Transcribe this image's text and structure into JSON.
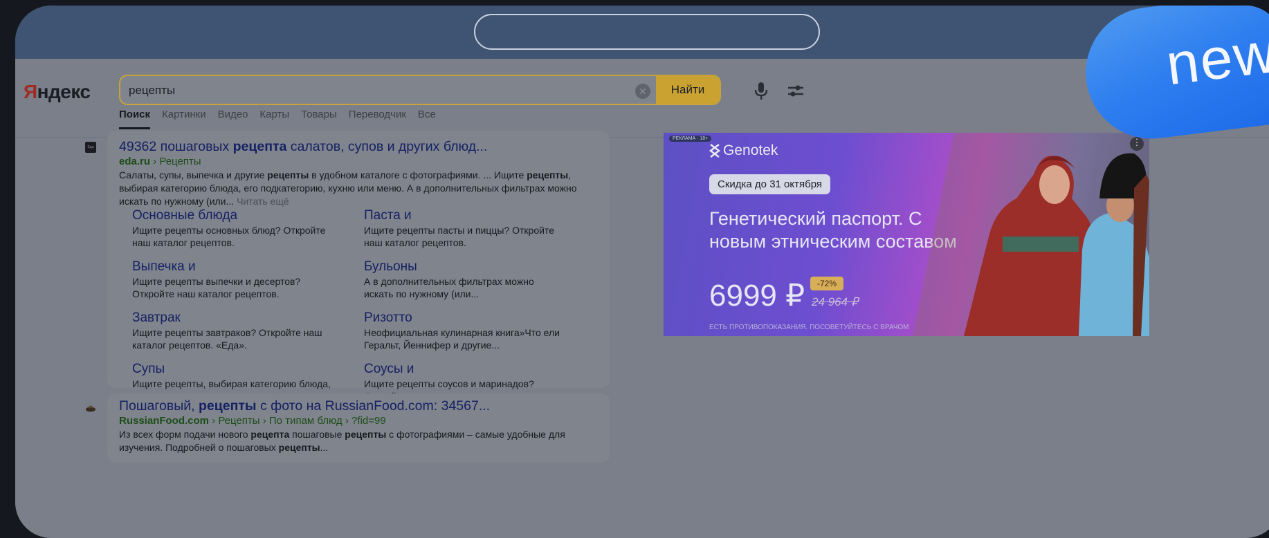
{
  "browser": {
    "address_bar_value": ""
  },
  "logo": {
    "first": "Я",
    "rest": "ндекс"
  },
  "search": {
    "query": "рецепты",
    "clear_icon": "clear-icon",
    "submit_label": "Найти"
  },
  "tabs": [
    "Поиск",
    "Картинки",
    "Видео",
    "Карты",
    "Товары",
    "Переводчик",
    "Все"
  ],
  "results": [
    {
      "favicon_text": "Еда",
      "title_pre": "49362 пошаговых ",
      "title_bold": "рецепта",
      "title_post": " салатов, супов и других блюд...",
      "domain": "eda.ru",
      "path": " › Рецепты",
      "snippet": [
        {
          "text": "Салаты, супы, выпечка и другие "
        },
        {
          "text": "рецепты",
          "bold": true
        },
        {
          "text": " в удобном каталоге с фотографиями. ... Ищите "
        },
        {
          "text": "рецепты",
          "bold": true
        },
        {
          "text": ", выбирая категорию блюда, его подкатегорию, кухню или меню. А в дополнительных фильтрах можно искать по нужному (или... "
        }
      ],
      "read_more": "Читать ещё",
      "sitelinks": [
        {
          "title": "Основные блюда",
          "desc": "Ищите рецепты основных блюд? Откройте наш каталог рецептов."
        },
        {
          "title": "Паста и",
          "desc": "Ищите рецепты пасты и пиццы? Откройте наш каталог рецептов."
        },
        {
          "title": "Выпечка и",
          "desc": "Ищите рецепты выпечки и десертов? Откройте наш каталог рецептов."
        },
        {
          "title": "Бульоны",
          "desc": "А в дополнительных фильтрах можно искать по нужному (или..."
        },
        {
          "title": "Завтрак",
          "desc": "Ищите рецепты завтраков? Откройте наш каталог рецептов. «Еда»."
        },
        {
          "title": "Ризотто",
          "desc": "Неофициальная кулинарная книга»Что ели Геральт, Йеннифер и другие..."
        },
        {
          "title": "Супы",
          "desc": "Ищите рецепты, выбирая категорию блюда, его подкатегорию, кухню..."
        },
        {
          "title": "Соусы и",
          "desc": "Ищите рецепты соусов и маринадов? Откройте наш каталог рецептов."
        }
      ]
    },
    {
      "title_pre": "Пошаговый, ",
      "title_bold": "рецепты",
      "title_post": " с фото на RussianFood.com: 34567...",
      "domain": "RussianFood.com",
      "path": " › Рецепты › По типам блюд › ?fid=99",
      "snippet": [
        {
          "text": "Из всех форм подачи нового "
        },
        {
          "text": "рецепта",
          "bold": true
        },
        {
          "text": " пошаговые "
        },
        {
          "text": "рецепты",
          "bold": true
        },
        {
          "text": " с фотографиями – самые удобные для изучения. Подробней о пошаговых "
        },
        {
          "text": "рецепты",
          "bold": true
        },
        {
          "text": "..."
        }
      ]
    }
  ],
  "ad": {
    "label": "РЕКЛАМА · 18+",
    "brand": "Genotek",
    "promo": "Скидка до 31 октября",
    "headline": "Генетический паспорт. С новым этническим составом",
    "price": "6999 ₽",
    "discount": "-72%",
    "old_price": "24 964 ₽",
    "disclaimer": "ЕСТЬ ПРОТИВОПОКАЗАНИЯ. ПОСОВЕТУЙТЕСЬ С ВРАЧОМ",
    "menu_icon": "more-vertical-icon"
  },
  "badge": {
    "text": "new"
  }
}
